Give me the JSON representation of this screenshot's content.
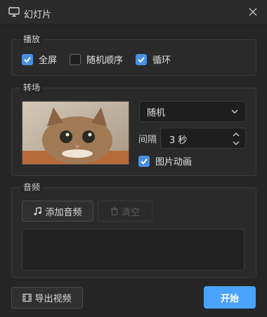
{
  "window": {
    "title": "幻灯片",
    "app_icon": "monitor-icon",
    "close_icon": "close-icon"
  },
  "playback": {
    "label": "播放",
    "fullscreen": {
      "label": "全屏",
      "checked": true
    },
    "random_order": {
      "label": "随机顺序",
      "checked": false
    },
    "loop": {
      "label": "循环",
      "checked": true
    }
  },
  "transition": {
    "label": "转场",
    "preview_icon": "cat-photo",
    "effect_value": "随机",
    "interval_label": "间隔",
    "interval_value": "3 秒",
    "image_animation": {
      "label": "图片动画",
      "checked": true
    }
  },
  "audio": {
    "label": "音频",
    "add_button": "添加音频",
    "add_icon": "music-note-icon",
    "clear_button": "清空",
    "clear_icon": "trash-icon"
  },
  "footer": {
    "export_button": "导出视频",
    "export_icon": "film-icon",
    "start_button": "开始"
  },
  "colors": {
    "accent": "#4a90e2",
    "primary_button": "#4aa3ff",
    "background": "#262626"
  }
}
